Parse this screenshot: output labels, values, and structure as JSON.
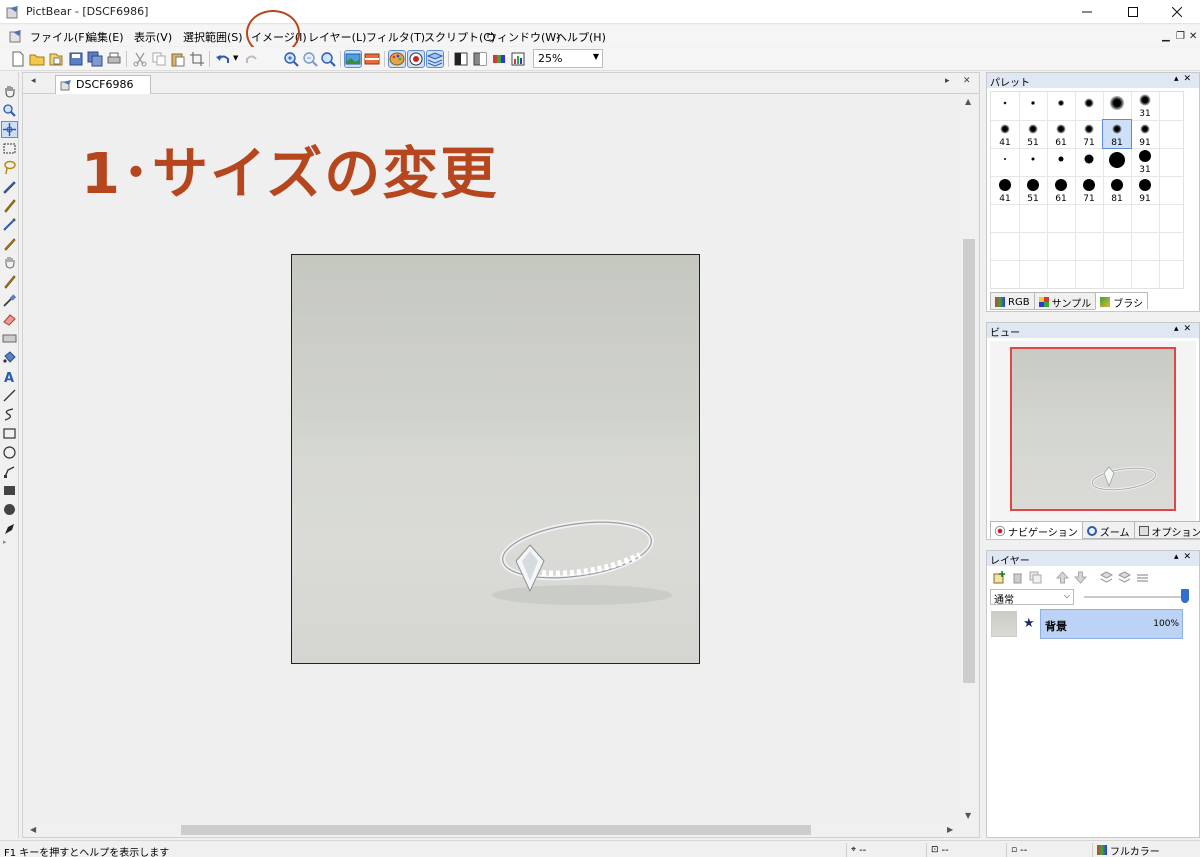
{
  "window": {
    "title": "PictBear - [DSCF6986]"
  },
  "menu": [
    {
      "label": "ファイル(F)"
    },
    {
      "label": "編集(E)"
    },
    {
      "label": "表示(V)"
    },
    {
      "label": "選択範囲(S)"
    },
    {
      "label": "イメージ(I)"
    },
    {
      "label": "レイヤー(L)"
    },
    {
      "label": "フィルタ(T)"
    },
    {
      "label": "スクリプト(C)"
    },
    {
      "label": "ウィンドウ(W)"
    },
    {
      "label": "ヘルプ(H)"
    }
  ],
  "toolbar": {
    "zoom_value": "25%"
  },
  "document": {
    "tab_label": "DSCF6986",
    "overlay_heading": "1･サイズの変更"
  },
  "panels": {
    "palette": {
      "title": "パレット",
      "brush_rows": [
        [
          "",
          "",
          "",
          "",
          "",
          "31"
        ],
        [
          "41",
          "51",
          "61",
          "71",
          "81",
          "91"
        ],
        [
          "",
          "",
          "",
          "",
          "",
          "31"
        ],
        [
          "41",
          "51",
          "61",
          "71",
          "81",
          "91"
        ]
      ],
      "selected_brush": "81",
      "tabs": [
        "RGB",
        "サンプル",
        "ブラシ"
      ],
      "active_tab": "ブラシ"
    },
    "view": {
      "title": "ビュー",
      "tabs": [
        "ナビゲーション",
        "ズーム",
        "オプション"
      ],
      "active_tab": "ナビゲーション"
    },
    "layers": {
      "title": "レイヤー",
      "blend_mode": "通常",
      "opacity": 100,
      "items": [
        {
          "name": "背景",
          "opacity_label": "100%"
        }
      ]
    }
  },
  "status": {
    "help_text": "F1 キーを押すとヘルプを表示します",
    "position": "--",
    "size": "--",
    "dash": "--",
    "color_mode": "フルカラー"
  },
  "colors": {
    "accent_annotation": "#b5461d",
    "selection": "#cde0f7",
    "view_frame": "#e14646"
  }
}
